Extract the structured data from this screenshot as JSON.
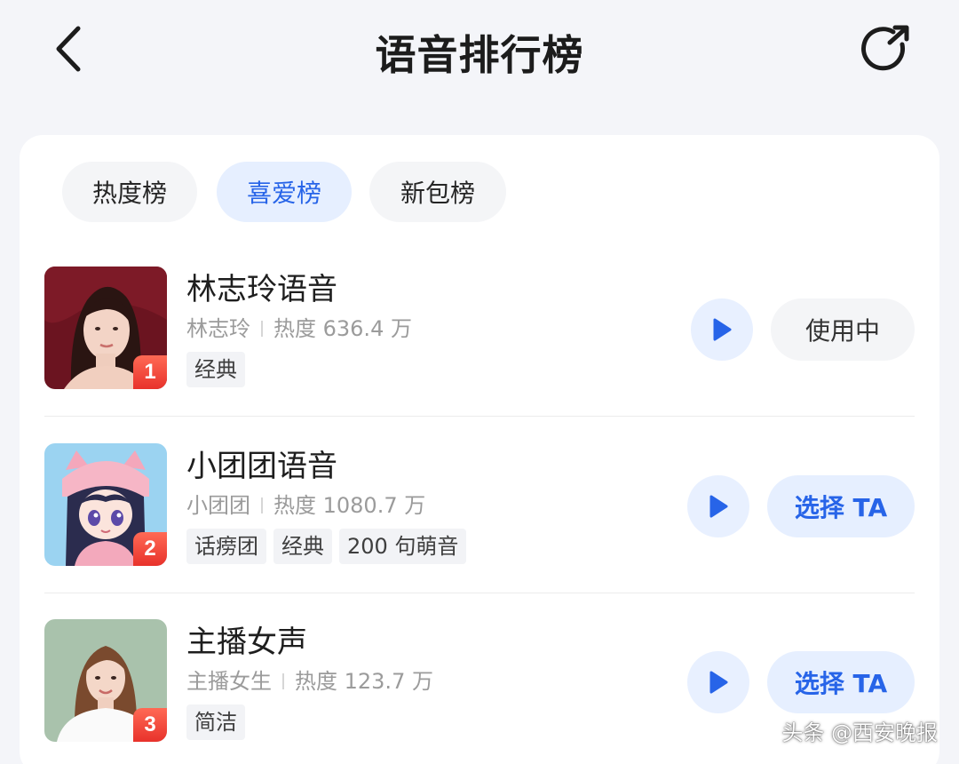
{
  "header": {
    "title": "语音排行榜",
    "back_icon": "chevron-left-icon",
    "share_icon": "share-icon"
  },
  "tabs": [
    {
      "label": "热度榜",
      "active": false
    },
    {
      "label": "喜爱榜",
      "active": true
    },
    {
      "label": "新包榜",
      "active": false
    }
  ],
  "list": [
    {
      "rank": "1",
      "name": "林志玲语音",
      "author": "林志玲",
      "heat": "热度 636.4 万",
      "tags": [
        "经典"
      ],
      "action": "使用中"
    },
    {
      "rank": "2",
      "name": "小团团语音",
      "author": "小团团",
      "heat": "热度 1080.7 万",
      "tags": [
        "话痨团",
        "经典",
        "200 句萌音"
      ],
      "action": "选择 TA"
    },
    {
      "rank": "3",
      "name": "主播女声",
      "author": "主播女生",
      "heat": "热度 123.7 万",
      "tags": [
        "简洁"
      ],
      "action": "选择 TA"
    }
  ],
  "watermark": "头条 @西安晚报",
  "colors": {
    "accent": "#2764e8",
    "accent_bg": "#e6efff",
    "rank_badge": "#e8322b",
    "page_bg": "#f4f5f9"
  }
}
